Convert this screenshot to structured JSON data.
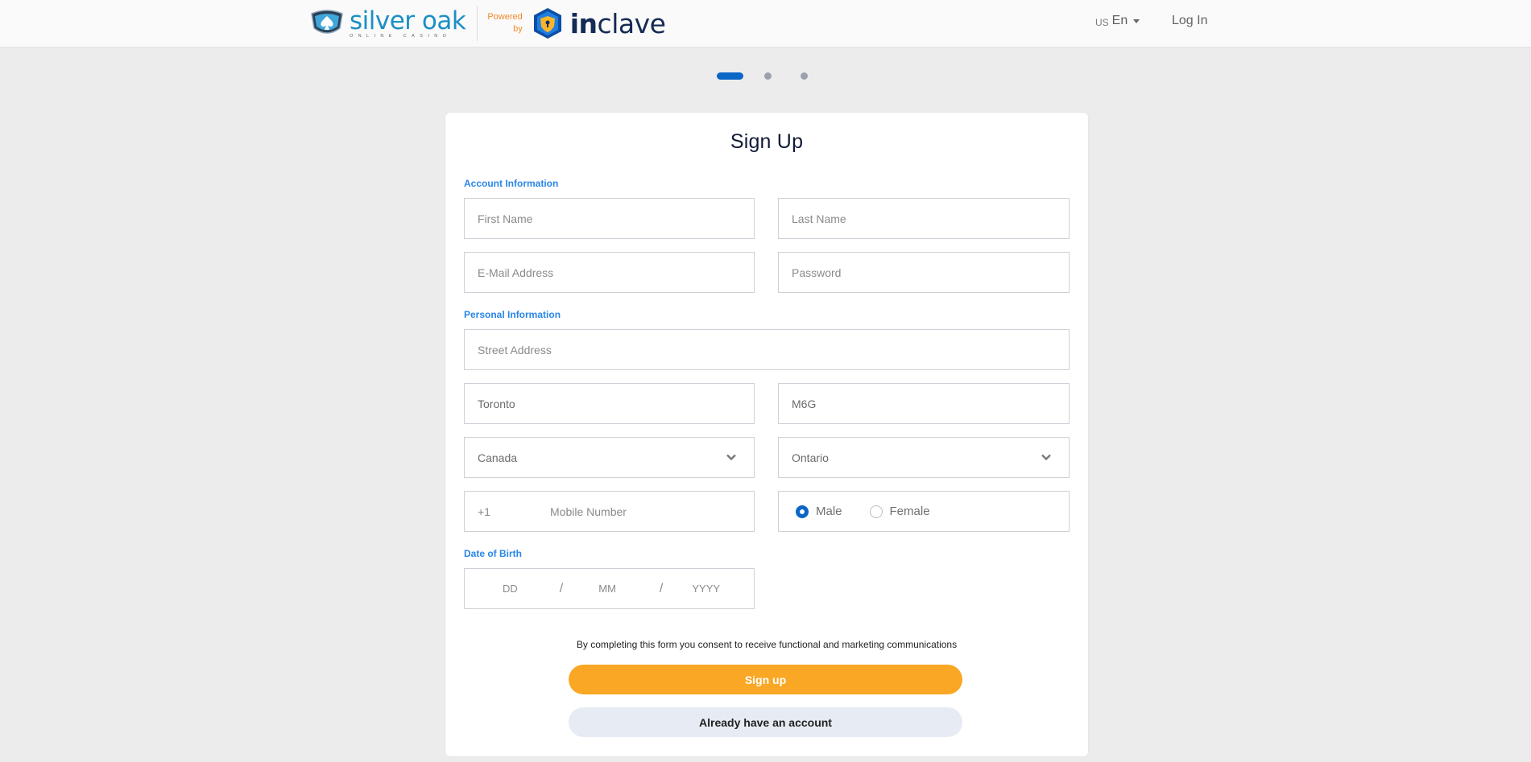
{
  "header": {
    "brand_name": "silver oak",
    "brand_tagline": "ONLINE CASINO",
    "powered_line1": "Powered",
    "powered_line2": "by",
    "partner_name_bold": "in",
    "partner_name_rest": "clave",
    "language": {
      "code": "US",
      "label": "En"
    },
    "login_label": "Log In"
  },
  "stepper": {
    "current_step": 1,
    "total_steps": 3
  },
  "form": {
    "title": "Sign Up",
    "sections": {
      "account": "Account Information",
      "personal": "Personal Information",
      "dob": "Date of Birth"
    },
    "fields": {
      "first_name": {
        "placeholder": "First Name",
        "value": ""
      },
      "last_name": {
        "placeholder": "Last Name",
        "value": ""
      },
      "email": {
        "placeholder": "E-Mail Address",
        "value": ""
      },
      "password": {
        "placeholder": "Password",
        "value": ""
      },
      "street": {
        "placeholder": "Street Address",
        "value": ""
      },
      "city": {
        "value": "Toronto"
      },
      "postal": {
        "value": "M6G"
      },
      "country": {
        "value": "Canada"
      },
      "province": {
        "value": "Ontario"
      },
      "phone_code": {
        "value": "+1"
      },
      "mobile": {
        "placeholder": "Mobile Number",
        "value": ""
      },
      "gender": {
        "options": [
          "Male",
          "Female"
        ],
        "selected": "Male"
      },
      "dob": {
        "day_placeholder": "DD",
        "month_placeholder": "MM",
        "year_placeholder": "YYYY",
        "separator": "/"
      }
    },
    "consent_text": "By completing this form you consent to receive functional and marketing communications",
    "signup_label": "Sign up",
    "have_account_label": "Already have an account"
  },
  "colors": {
    "primary_blue": "#0a66c7",
    "section_blue": "#2a86e8",
    "cta_orange": "#f9a724",
    "secondary_button": "#e6ebf4",
    "powered_orange": "#f08a2a",
    "background": "#ececec"
  }
}
